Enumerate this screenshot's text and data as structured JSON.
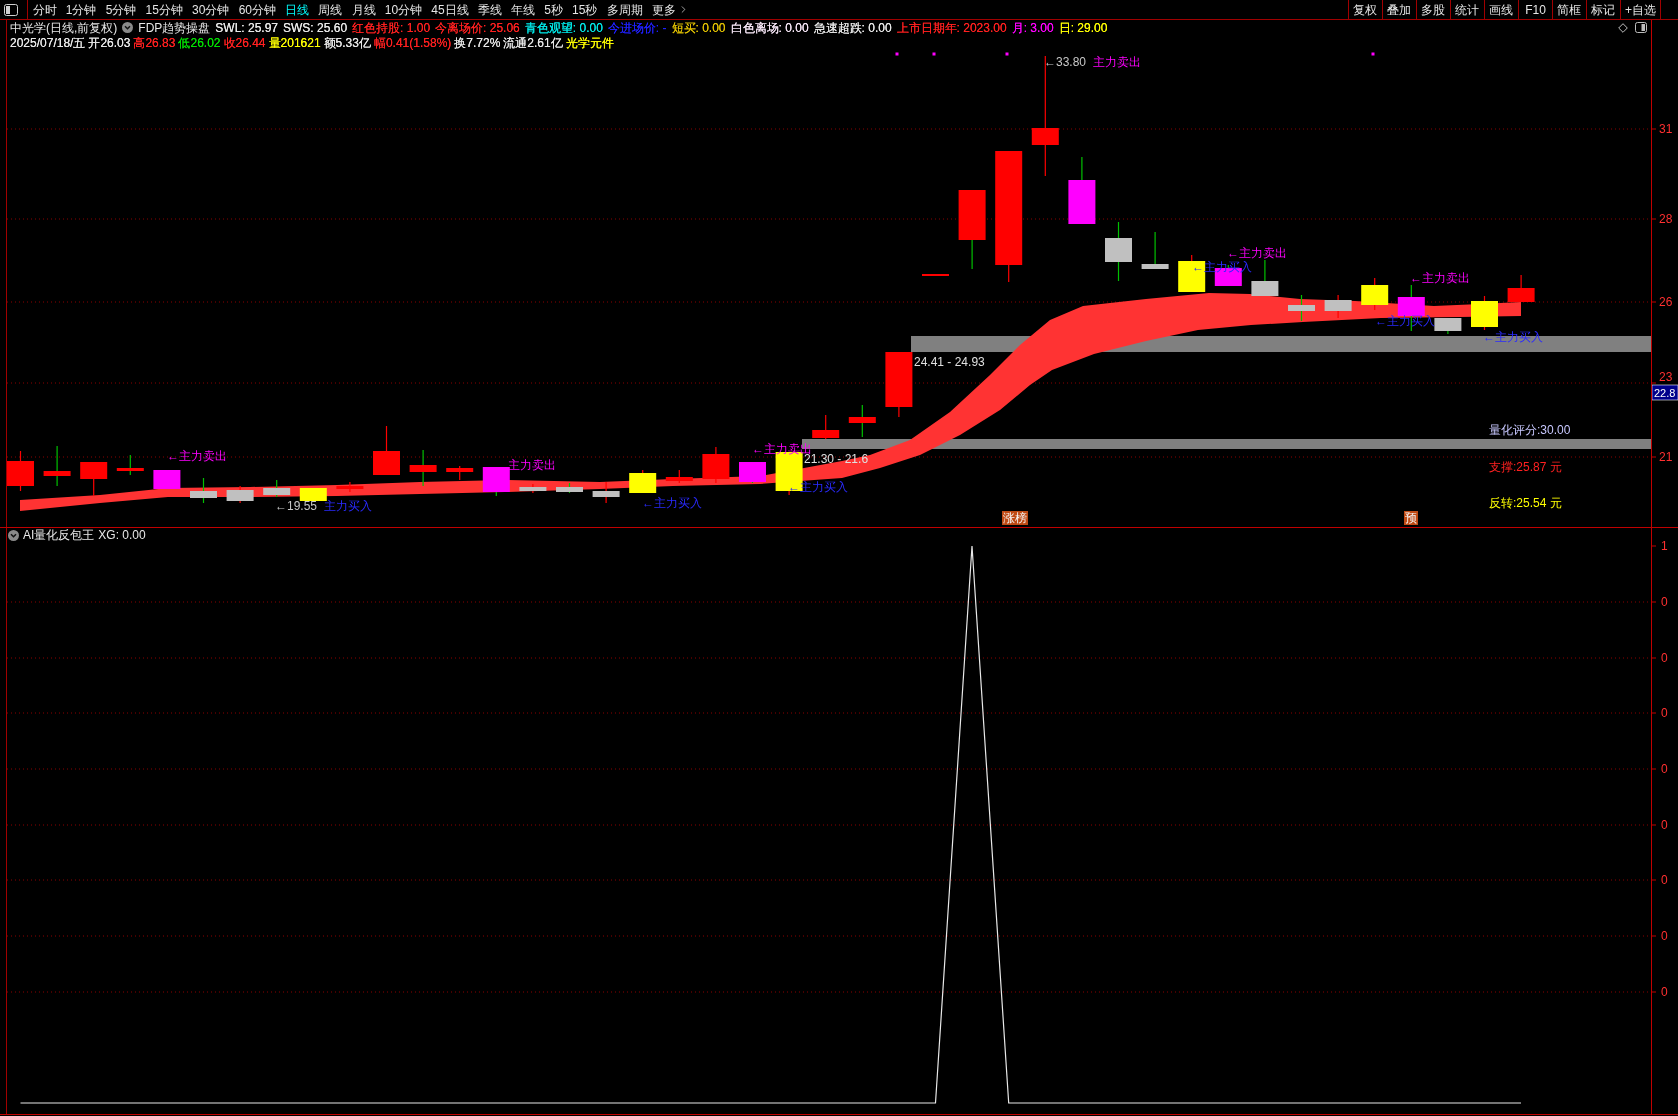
{
  "toolbar": {
    "periods": [
      {
        "label": "分时",
        "selected": false
      },
      {
        "label": "1分钟",
        "selected": false
      },
      {
        "label": "5分钟",
        "selected": false
      },
      {
        "label": "15分钟",
        "selected": false
      },
      {
        "label": "30分钟",
        "selected": false
      },
      {
        "label": "60分钟",
        "selected": false
      },
      {
        "label": "日线",
        "selected": true
      },
      {
        "label": "周线",
        "selected": false
      },
      {
        "label": "月线",
        "selected": false
      },
      {
        "label": "10分钟",
        "selected": false
      },
      {
        "label": "45日线",
        "selected": false
      },
      {
        "label": "季线",
        "selected": false
      },
      {
        "label": "年线",
        "selected": false
      },
      {
        "label": "5秒",
        "selected": false
      },
      {
        "label": "15秒",
        "selected": false
      },
      {
        "label": "多周期",
        "selected": false
      }
    ],
    "more": "更多",
    "tools": [
      "复权",
      "叠加",
      "多股",
      "统计",
      "画线",
      "F10",
      "简框",
      "标记",
      "+自选"
    ]
  },
  "header": {
    "stock": "中光学(日线,前复权)",
    "indicator": "FDP趋势操盘",
    "values": [
      {
        "text": "SWL: 25.97",
        "color": "#e8e8e8"
      },
      {
        "text": "SWS: 25.60",
        "color": "#e8e8e8"
      },
      {
        "text": "红色持股: 1.00",
        "color": "#ff2020"
      },
      {
        "text": "今离场价: 25.06",
        "color": "#ff2020"
      },
      {
        "text": "青色观望: 0.00",
        "color": "#00e8e8"
      },
      {
        "text": "今进场价: -",
        "color": "#2020ff"
      },
      {
        "text": "短买: 0.00",
        "color": "#e0c000"
      },
      {
        "text": "白色离场: 0.00",
        "color": "#f4e4f4"
      },
      {
        "text": "急速超跌: 0.00",
        "color": "#e8e8e8"
      },
      {
        "text": "上市日期年: 2023.00",
        "color": "#ff2020"
      },
      {
        "text": "月: 3.00",
        "color": "#ff00ff"
      },
      {
        "text": "日: 29.00",
        "color": "#ffff00"
      }
    ]
  },
  "quote": [
    {
      "text": "2025/07/18/五",
      "color": "#e8e8e8"
    },
    {
      "text": "开26.03",
      "color": "#e8e8e8"
    },
    {
      "text": "高26.83",
      "color": "#ff2020"
    },
    {
      "text": "低26.02",
      "color": "#00e000"
    },
    {
      "text": "收26.44",
      "color": "#ff2020"
    },
    {
      "text": "量201621",
      "color": "#ffff00"
    },
    {
      "text": "额5.33亿",
      "color": "#e8e8e8"
    },
    {
      "text": "幅0.41(1.58%)",
      "color": "#ff2020"
    },
    {
      "text": "换7.72%",
      "color": "#e8e8e8"
    },
    {
      "text": "流通2.61亿",
      "color": "#e8e8e8"
    },
    {
      "text": "光学元件",
      "color": "#ffff00"
    }
  ],
  "main_chart": {
    "signals": [
      {
        "kind": "sell",
        "text": "←主力卖出"
      },
      {
        "kind": "buy",
        "text": "主力买入"
      },
      {
        "kind": "sell",
        "text": "主力卖出"
      },
      {
        "kind": "buy",
        "text": "←主力买入"
      },
      {
        "kind": "sell",
        "text": "←主力卖出"
      },
      {
        "kind": "buy",
        "text": "←主力买入"
      },
      {
        "kind": "sell",
        "text": "主力卖出"
      },
      {
        "kind": "buy",
        "text": "←主力买入"
      },
      {
        "kind": "sell",
        "text": "←主力卖出"
      },
      {
        "kind": "buy",
        "text": "←主力买入"
      },
      {
        "kind": "sell",
        "text": "←主力卖出"
      },
      {
        "kind": "buy",
        "text": "←主力买入"
      }
    ],
    "price_marks": [
      "←33.80",
      "←19.55"
    ],
    "ranges": [
      "24.41 - 24.93",
      "21.30 - 21.6"
    ],
    "readings": [
      {
        "text": "量化评分:30.00",
        "color": "#c8c8ff"
      },
      {
        "text": "支撑:25.87 元",
        "color": "#ff2020"
      },
      {
        "text": "反转:25.54 元",
        "color": "#ffff00"
      }
    ],
    "badges": [
      "涨榜",
      "预"
    ],
    "price_axis": [
      "31",
      "28",
      "26",
      "23",
      "21"
    ],
    "price_tag": "22.8"
  },
  "sub_chart": {
    "title": "AI量化反包王",
    "value": "XG: 0.00",
    "axis_labels": [
      "1",
      "0",
      "0",
      "0",
      "0",
      "0",
      "0",
      "0",
      "0"
    ]
  }
}
